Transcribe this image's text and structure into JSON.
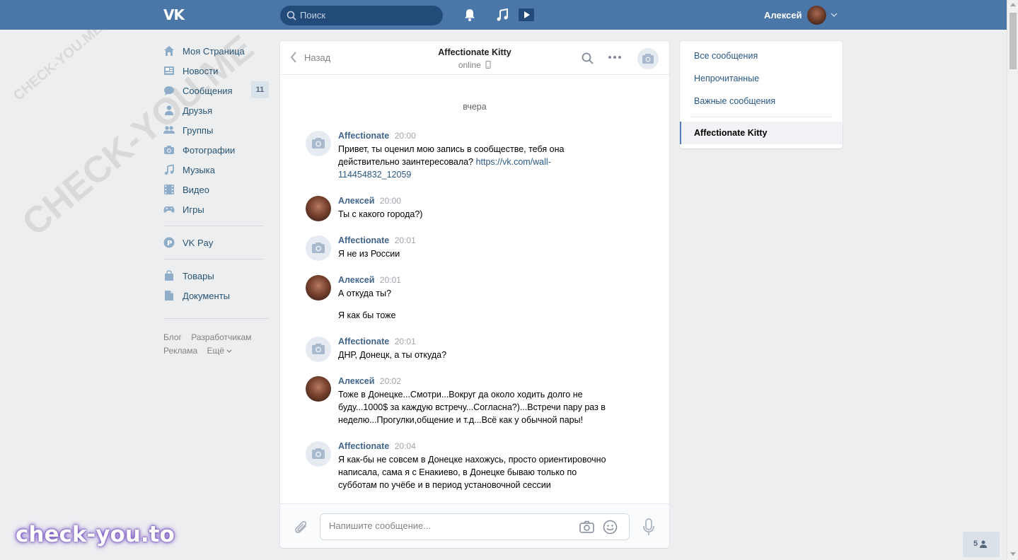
{
  "topbar": {
    "search_placeholder": "Поиск",
    "user_name": "Алексей"
  },
  "nav": {
    "items": [
      {
        "label": "Моя Страница",
        "icon": "home-icon"
      },
      {
        "label": "Новости",
        "icon": "news-icon"
      },
      {
        "label": "Сообщения",
        "icon": "messages-icon",
        "count": "11"
      },
      {
        "label": "Друзья",
        "icon": "friends-icon"
      },
      {
        "label": "Группы",
        "icon": "groups-icon"
      },
      {
        "label": "Фотографии",
        "icon": "camera-icon"
      },
      {
        "label": "Музыка",
        "icon": "music-icon"
      },
      {
        "label": "Видео",
        "icon": "video-icon"
      },
      {
        "label": "Игры",
        "icon": "gamepad-icon"
      }
    ],
    "vkpay": "VK Pay",
    "market": "Товары",
    "docs": "Документы",
    "footer": {
      "blog": "Блог",
      "dev": "Разработчикам",
      "ads": "Реклама",
      "more": "Ещё"
    }
  },
  "chat": {
    "back": "Назад",
    "title": "Affectionate Kitty",
    "status": "online",
    "day": "вчера",
    "messages": [
      {
        "author": "Affectionate",
        "time": "20:00",
        "text": "Привет, ты оценил мою запись в сообществе, тебя она действительно заинтересовала?",
        "link": "https://vk.com/wall-114454832_12059"
      },
      {
        "author": "Алексей",
        "time": "20:00",
        "text": "Ты с какого города?)"
      },
      {
        "author": "Affectionate",
        "time": "20:01",
        "text": "Я не из России"
      },
      {
        "author": "Алексей",
        "time": "20:01",
        "text": "А откуда ты?",
        "text2": "Я как бы тоже"
      },
      {
        "author": "Affectionate",
        "time": "20:01",
        "text": "ДНР, Донецк, а ты откуда?"
      },
      {
        "author": "Алексей",
        "time": "20:02",
        "text": "Тоже в Донецке...Смотри...Вокруг да около ходить долго не буду...1000$ за каждую встречу...Согласна?)...Встречи пару раз в неделю...Прогулки,общение и т.д...Всё как у обычной пары!"
      },
      {
        "author": "Affectionate",
        "time": "20:04",
        "text": "Я как-бы не совсем в Донецке нахожусь, просто ориентировочно написала, сама я с Енакиево, в Донецке бываю только по субботам по учёбе и в период установочной сессии"
      }
    ],
    "input_placeholder": "Напишите сообщение..."
  },
  "side": {
    "all": "Все сообщения",
    "unread": "Непрочитанные",
    "important": "Важные сообщения",
    "active": "Affectionate Kitty"
  },
  "online_count": "5",
  "watermarks": {
    "big": "CHECK-YOU.ME",
    "small": "CHECK-YOU.ME",
    "brand": "check-you.to"
  },
  "colors": {
    "header": "#4a76a8",
    "link": "#2a5885",
    "author": "#42648b"
  }
}
